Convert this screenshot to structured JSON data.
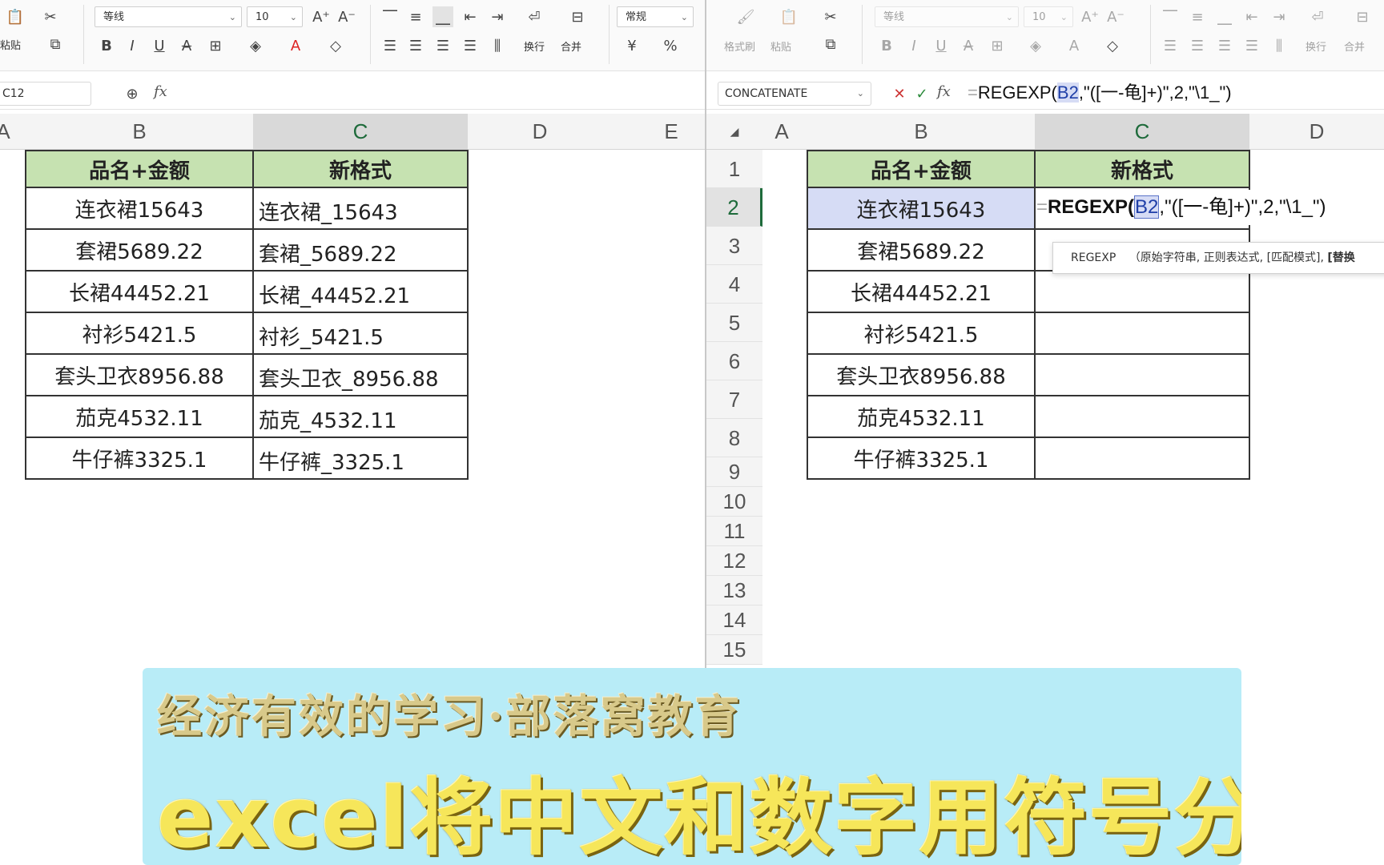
{
  "left_panel": {
    "ribbon": {
      "paste_label": "粘贴",
      "font_name": "等线",
      "font_size": "10",
      "number_format": "常规",
      "wrap_label": "换行",
      "merge_label": "合并",
      "currency_symbol": "¥",
      "percent_symbol": "%"
    },
    "name_box": "C12",
    "formula": "",
    "columns": [
      "A",
      "B",
      "C",
      "D",
      "E"
    ],
    "table": {
      "headers": [
        "品名+金额",
        "新格式"
      ],
      "rows": [
        [
          "连衣裙15643",
          "连衣裙_15643"
        ],
        [
          "套裙5689.22",
          "套裙_5689.22"
        ],
        [
          "长裙44452.21",
          "长裙_44452.21"
        ],
        [
          "衬衫5421.5",
          "衬衫_5421.5"
        ],
        [
          "套头卫衣8956.88",
          "套头卫衣_8956.88"
        ],
        [
          "茄克4532.11",
          "茄克_4532.11"
        ],
        [
          "牛仔裤3325.1",
          "牛仔裤_3325.1"
        ]
      ]
    }
  },
  "right_panel": {
    "ribbon": {
      "format_painter_label": "格式刷",
      "paste_label": "粘贴",
      "font_name": "等线",
      "font_size": "10",
      "wrap_label": "换行",
      "merge_label": "合并"
    },
    "name_box": "CONCATENATE",
    "formula_prefix": "=",
    "formula_fn": "REGEXP(",
    "formula_ref": "B2",
    "formula_rest": ",\"([一-龟]+)\",2,\"\\1_\")",
    "columns": [
      "A",
      "B",
      "C",
      "D"
    ],
    "row_numbers": [
      "1",
      "2",
      "3",
      "4",
      "5",
      "6",
      "7",
      "8",
      "9",
      "10",
      "11",
      "12",
      "13",
      "14",
      "15"
    ],
    "cell_edit": {
      "prefix": "=",
      "fn": "REGEXP(",
      "ref": "B2",
      "rest": ",\"([一-龟]+)\",2,\"\\1_\")"
    },
    "tooltip": {
      "fn": "REGEXP",
      "args": "（原始字符串, 正则表达式, [匹配模式], ",
      "bold_arg": "[替换"
    },
    "table": {
      "headers": [
        "品名+金额",
        "新格式"
      ],
      "rows": [
        [
          "连衣裙15643",
          ""
        ],
        [
          "套裙5689.22",
          ""
        ],
        [
          "长裙44452.21",
          ""
        ],
        [
          "衬衫5421.5",
          ""
        ],
        [
          "套头卫衣8956.88",
          ""
        ],
        [
          "茄克4532.11",
          ""
        ],
        [
          "牛仔裤3325.1",
          ""
        ]
      ]
    }
  },
  "banner": {
    "subtitle": "经济有效的学习·部落窝教育",
    "title": "excel将中文和数字用符号分隔开"
  },
  "colors": {
    "header_fill": "#c6e2b1",
    "selection_fill": "#d6dcf5",
    "accent_green": "#1e6b3b",
    "banner_bg": "#b8ecf7",
    "banner_text": "#f6e65a"
  }
}
